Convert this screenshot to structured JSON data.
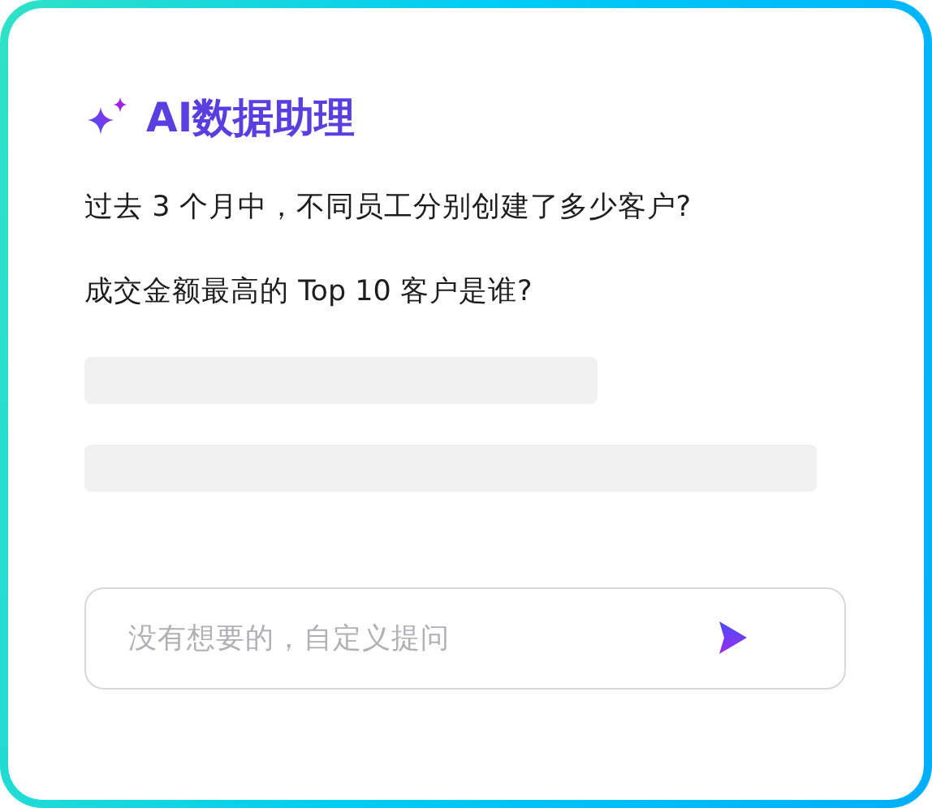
{
  "title": "AI数据助理",
  "suggestions": [
    "过去 3 个月中，不同员工分别创建了多少客户?",
    "成交金额最高的 Top 10 客户是谁?"
  ],
  "input": {
    "placeholder": "没有想要的，自定义提问"
  }
}
